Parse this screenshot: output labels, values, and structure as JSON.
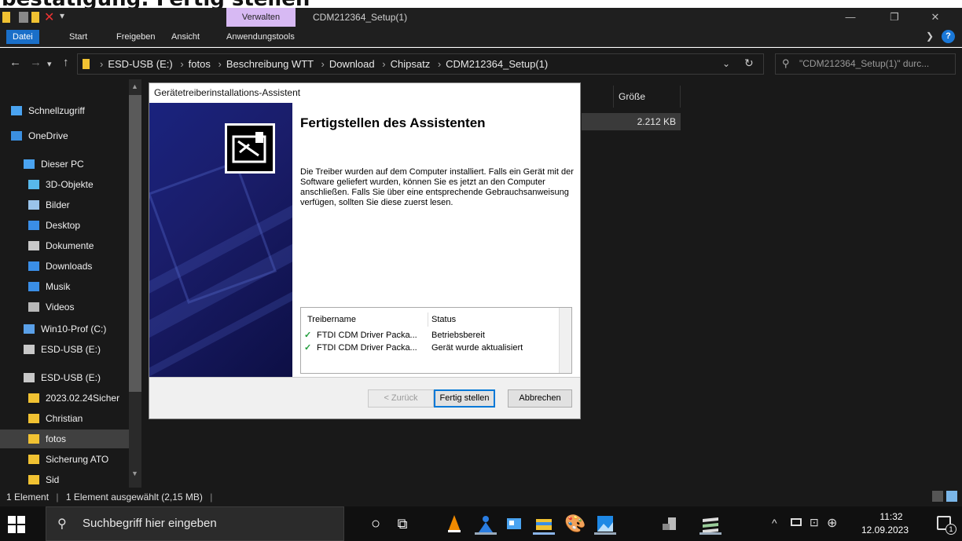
{
  "top_strip_text": "bestatigung: Fertig stellen",
  "titlebar": {
    "contextual_tab": "Verwalten",
    "window_title": "CDM212364_Setup(1)"
  },
  "ribbon": {
    "tabs": [
      "Datei",
      "Start",
      "Freigeben",
      "Ansicht",
      "Anwendungstools"
    ],
    "help": "?"
  },
  "address": {
    "crumbs": [
      "ESD-USB (E:)",
      "fotos",
      "Beschreibung WTT",
      "Download",
      "Chipsatz",
      "CDM212364_Setup(1)"
    ],
    "search_placeholder": "\"CDM212364_Setup(1)\" durc..."
  },
  "sidebar": {
    "items": [
      {
        "label": "Schnellzugriff",
        "icon": "star-icon",
        "color": "#4aa3f0"
      },
      {
        "label": "OneDrive",
        "icon": "cloud-icon",
        "color": "#3b8fe0"
      },
      {
        "label": "Dieser PC",
        "icon": "pc-icon",
        "color": "#4aa3f0"
      },
      {
        "label": "3D-Objekte",
        "icon": "cube-icon",
        "color": "#58b8ea"
      },
      {
        "label": "Bilder",
        "icon": "pictures-icon",
        "color": "#9ac4ea"
      },
      {
        "label": "Desktop",
        "icon": "desktop-icon",
        "color": "#3a8ee6"
      },
      {
        "label": "Dokumente",
        "icon": "documents-icon",
        "color": "#c8c8c8"
      },
      {
        "label": "Downloads",
        "icon": "download-icon",
        "color": "#3a8ee6"
      },
      {
        "label": "Musik",
        "icon": "music-icon",
        "color": "#3a8ee6"
      },
      {
        "label": "Videos",
        "icon": "videos-icon",
        "color": "#b8b8b8"
      },
      {
        "label": "Win10-Prof (C:)",
        "icon": "drive-icon",
        "color": "#5aa0e8"
      },
      {
        "label": "ESD-USB (E:)",
        "icon": "usb-drive-icon",
        "color": "#c8c8c8"
      },
      {
        "label": "ESD-USB (E:)",
        "icon": "usb-drive-icon",
        "color": "#c8c8c8"
      },
      {
        "label": "2023.02.24Sicher",
        "icon": "folder-icon",
        "color": "#f1c232"
      },
      {
        "label": "Christian",
        "icon": "folder-icon",
        "color": "#f1c232"
      },
      {
        "label": "fotos",
        "icon": "folder-icon",
        "color": "#f1c232"
      },
      {
        "label": "Sicherung ATO",
        "icon": "folder-icon",
        "color": "#f1c232"
      },
      {
        "label": "Sid",
        "icon": "folder-icon",
        "color": "#f1c232"
      }
    ]
  },
  "content": {
    "column_size": "Größe",
    "row_size": "2.212 KB"
  },
  "dialog": {
    "title": "Gerätetreiberinstallations-Assistent",
    "heading": "Fertigstellen des Assistenten",
    "body": "Die Treiber wurden auf dem Computer installiert. Falls ein Gerät mit der Software geliefert wurden, können Sie es jetzt an den Computer anschließen. Falls Sie über eine entsprechende Gebrauchsanweisung verfügen, sollten Sie diese zuerst lesen.",
    "list": {
      "col_name": "Treibername",
      "col_status": "Status",
      "rows": [
        {
          "name": "FTDI CDM Driver Packa...",
          "status": "Betriebsbereit"
        },
        {
          "name": "FTDI CDM Driver Packa...",
          "status": "Gerät wurde aktualisiert"
        }
      ]
    },
    "buttons": {
      "back": "< Zurück",
      "finish": "Fertig stellen",
      "cancel": "Abbrechen"
    }
  },
  "statusbar": {
    "count": "1 Element",
    "selected": "1 Element ausgewählt (2,15 MB)"
  },
  "taskbar": {
    "search_placeholder": "Suchbegriff hier eingeben",
    "time": "11:32",
    "date": "12.09.2023",
    "notifications": "1"
  }
}
